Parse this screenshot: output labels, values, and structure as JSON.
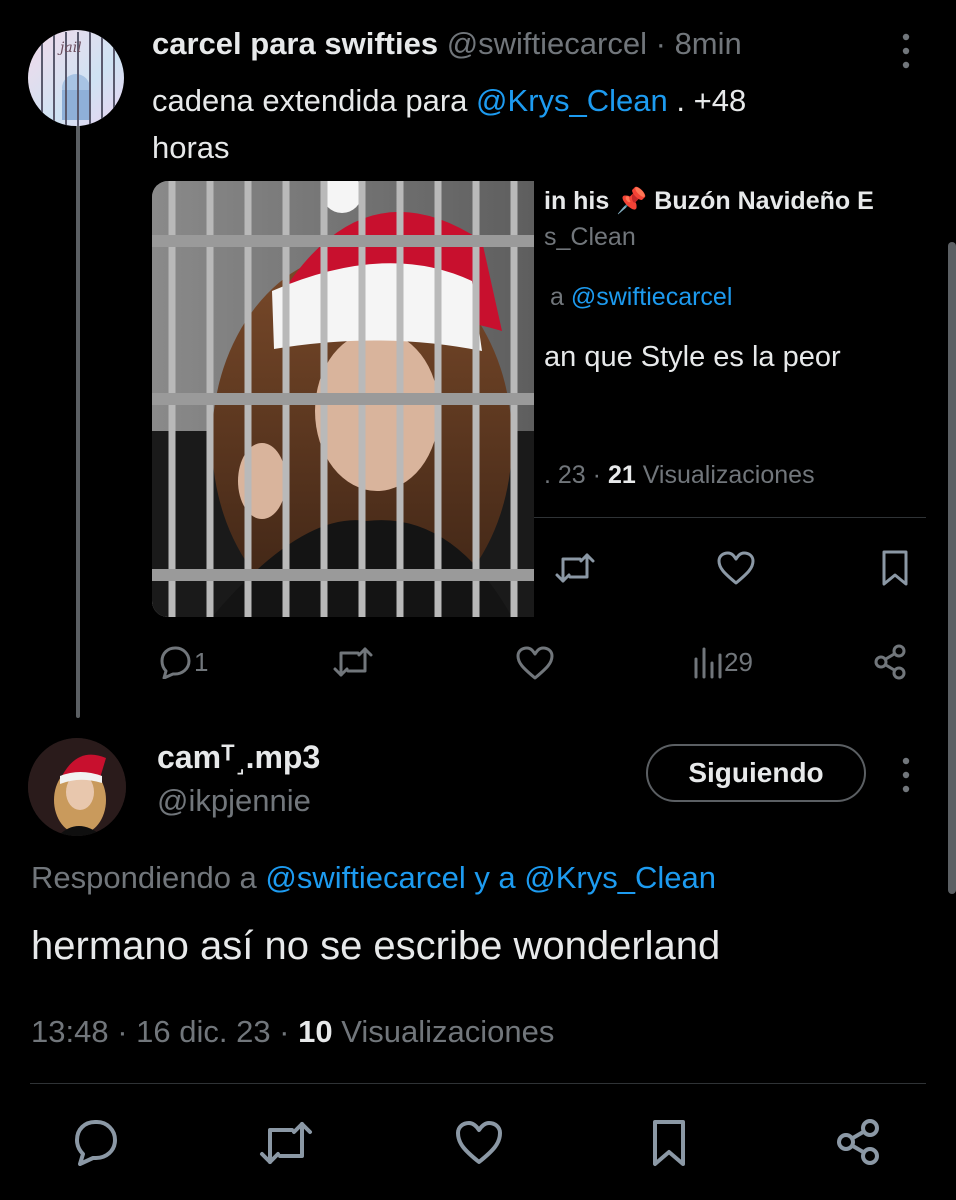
{
  "parent_tweet": {
    "display_name": "carcel para swifties",
    "handle": "@swiftiecarcel",
    "separator": "·",
    "time": "8min",
    "text_prefix": "cadena extendida para",
    "mention": "@Krys_Clean",
    "text_suffix": ". +48",
    "text_line2": "horas",
    "avatar_text": "jail",
    "actions": {
      "replies": "1",
      "views": "29"
    }
  },
  "embedded_screenshot": {
    "line1": "in his 📌 Buzón Navideño E",
    "line2": "s_Clean",
    "reply_prefix": "a",
    "reply_mention": "@swiftiecarcel",
    "body": "an que Style es la peor",
    "meta_date": ". 23 ·",
    "meta_views": "21",
    "meta_views_label": "Visualizaciones"
  },
  "reply_tweet": {
    "display_name": "camᵀ˼.mp3",
    "handle": "@ikpjennie",
    "follow_label": "Siguiendo",
    "replying_to_prefix": "Respondiendo a",
    "replying_to_mentions": "@swiftiecarcel y a @Krys_Clean",
    "text": "hermano así no se escribe wonderland",
    "timestamp": "13:48 · 16 dic. 23 ·",
    "views": "10",
    "views_label": "Visualizaciones"
  },
  "colors": {
    "background": "#000000",
    "text": "#e7e9ea",
    "muted": "#71767b",
    "link": "#1d9bf0",
    "santa_red": "#c8102e"
  },
  "icons": [
    "more-vertical-icon",
    "reply-icon",
    "retweet-icon",
    "like-icon",
    "views-icon",
    "share-icon",
    "bookmark-icon"
  ]
}
